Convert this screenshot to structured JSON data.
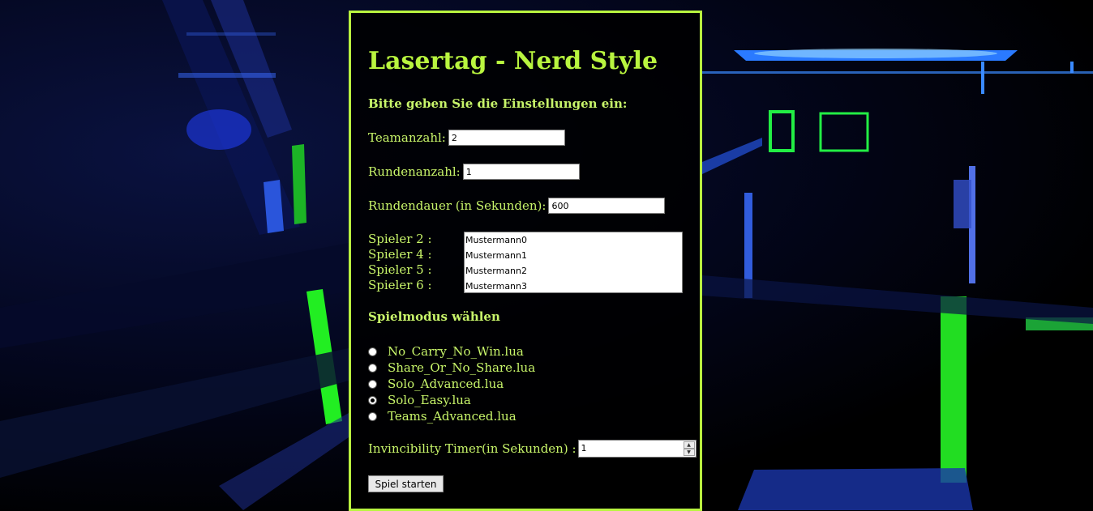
{
  "page": {
    "title": "Lasertag - Nerd Style",
    "subtitle": "Bitte geben Sie die Einstellungen ein:",
    "accent_color": "#b9f53f"
  },
  "fields": {
    "teams": {
      "label": "Teamanzahl:",
      "value": "2"
    },
    "rounds": {
      "label": "Rundenanzahl:",
      "value": "1"
    },
    "duration": {
      "label": "Rundendauer (in Sekunden):",
      "value": "600"
    }
  },
  "players": {
    "labels": [
      "Spieler 2 :",
      "Spieler 4 :",
      "Spieler 5 :",
      "Spieler 6 :"
    ],
    "names": [
      "Mustermann0",
      "Mustermann1",
      "Mustermann2",
      "Mustermann3"
    ]
  },
  "game_mode": {
    "title": "Spielmodus wählen",
    "options": [
      {
        "label": "No_Carry_No_Win.lua",
        "checked": false
      },
      {
        "label": "Share_Or_No_Share.lua",
        "checked": false
      },
      {
        "label": "Solo_Advanced.lua",
        "checked": false
      },
      {
        "label": "Solo_Easy.lua",
        "checked": true
      },
      {
        "label": "Teams_Advanced.lua",
        "checked": false
      }
    ]
  },
  "timer": {
    "label": "Invincibility Timer(in Sekunden) :",
    "value": "1"
  },
  "start_button": {
    "label": "Spiel starten"
  }
}
